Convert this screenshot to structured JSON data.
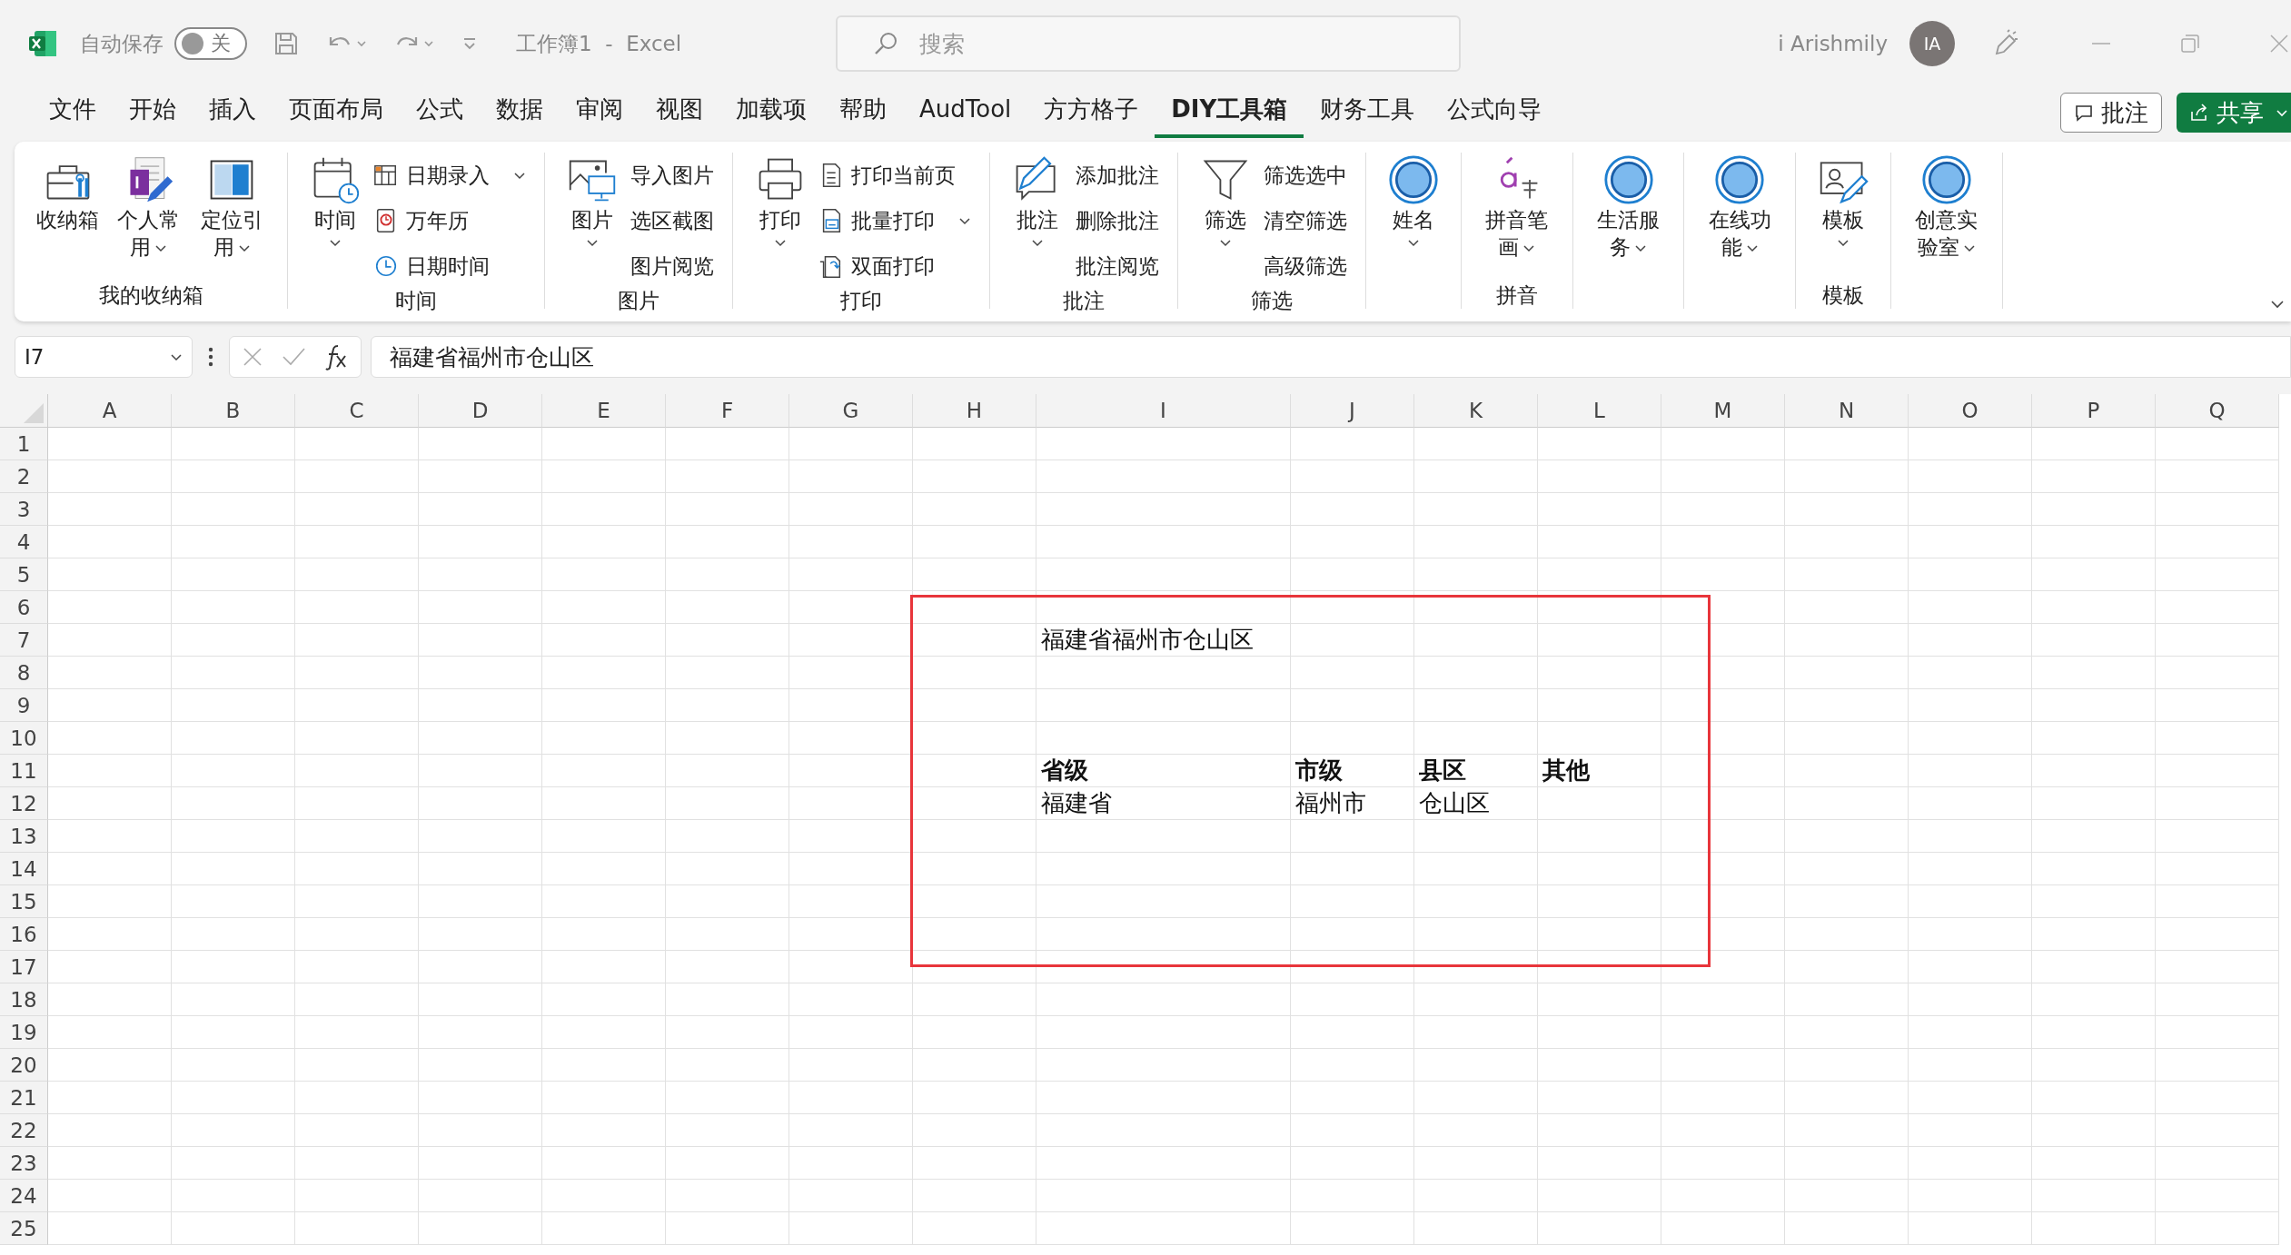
{
  "title_bar": {
    "autosave_label": "自动保存",
    "autosave": {
      "on": false,
      "label": "关"
    },
    "title": "工作簿1  -  Excel",
    "search": {
      "placeholder": "搜索"
    },
    "user": "i Arishmily",
    "avatar": "IA"
  },
  "tabs": [
    {
      "label": "文件",
      "selected": false
    },
    {
      "label": "开始",
      "selected": false
    },
    {
      "label": "插入",
      "selected": false
    },
    {
      "label": "页面布局",
      "selected": false
    },
    {
      "label": "公式",
      "selected": false
    },
    {
      "label": "数据",
      "selected": false
    },
    {
      "label": "审阅",
      "selected": false
    },
    {
      "label": "视图",
      "selected": false
    },
    {
      "label": "加载项",
      "selected": false
    },
    {
      "label": "帮助",
      "selected": false
    },
    {
      "label": "AudTool",
      "selected": false
    },
    {
      "label": "方方格子",
      "selected": false
    },
    {
      "label": "DIY工具箱",
      "selected": true
    },
    {
      "label": "财务工具",
      "selected": false
    },
    {
      "label": "公式向导",
      "selected": false
    }
  ],
  "actions": [
    {
      "kind": "comment",
      "label": "批注"
    },
    {
      "kind": "share",
      "label": "共享"
    }
  ],
  "ribbon": {
    "groups": [
      {
        "label": "我的收纳箱",
        "items": [
          {
            "kind": "large",
            "label": "收纳箱",
            "dropdown": false
          },
          {
            "kind": "large",
            "label": "个人常用",
            "dropdown": true
          },
          {
            "kind": "large",
            "label": "定位引用",
            "dropdown": true
          }
        ]
      },
      {
        "label": "时间",
        "items": [
          {
            "kind": "large",
            "label": "时间",
            "dropdown": true
          },
          {
            "kind": "small",
            "label": "日期录入",
            "dropdown": true
          },
          {
            "kind": "small",
            "label": "万年历",
            "dropdown": false
          },
          {
            "kind": "small",
            "label": "日期时间",
            "dropdown": false
          }
        ]
      },
      {
        "label": "图片",
        "items": [
          {
            "kind": "large",
            "label": "图片",
            "dropdown": true
          },
          {
            "kind": "plain",
            "label": "导入图片",
            "dropdown": false
          },
          {
            "kind": "plain",
            "label": "选区截图",
            "dropdown": false
          },
          {
            "kind": "plain",
            "label": "图片阅览",
            "dropdown": false
          }
        ]
      },
      {
        "label": "打印",
        "items": [
          {
            "kind": "large",
            "label": "打印",
            "dropdown": true
          },
          {
            "kind": "small",
            "label": "打印当前页",
            "dropdown": false
          },
          {
            "kind": "small",
            "label": "批量打印",
            "dropdown": true
          },
          {
            "kind": "small",
            "label": "双面打印",
            "dropdown": false
          }
        ]
      },
      {
        "label": "批注",
        "items": [
          {
            "kind": "large",
            "label": "批注",
            "dropdown": true
          },
          {
            "kind": "plain",
            "label": "添加批注",
            "dropdown": false
          },
          {
            "kind": "plain",
            "label": "删除批注",
            "dropdown": false
          },
          {
            "kind": "plain",
            "label": "批注阅览",
            "dropdown": false
          }
        ]
      },
      {
        "label": "筛选",
        "items": [
          {
            "kind": "large",
            "label": "筛选",
            "dropdown": true
          },
          {
            "kind": "plain",
            "label": "筛选选中",
            "dropdown": false
          },
          {
            "kind": "plain",
            "label": "清空筛选",
            "dropdown": false
          },
          {
            "kind": "plain",
            "label": "高级筛选",
            "dropdown": false
          }
        ]
      },
      {
        "items": [
          {
            "kind": "circle",
            "label": "姓名",
            "dropdown": true
          }
        ]
      },
      {
        "label": "拼音",
        "items": [
          {
            "kind": "large",
            "label": "拼音笔画",
            "dropdown": true
          }
        ]
      },
      {
        "items": [
          {
            "kind": "circle",
            "label": "生活服务",
            "dropdown": true
          }
        ]
      },
      {
        "items": [
          {
            "kind": "circle",
            "label": "在线功能",
            "dropdown": true
          }
        ]
      },
      {
        "label": "模板",
        "items": [
          {
            "kind": "large",
            "label": "模板",
            "dropdown": true
          }
        ]
      },
      {
        "items": [
          {
            "kind": "circle",
            "label": "创意实验室",
            "dropdown": true
          }
        ]
      }
    ]
  },
  "formula_bar": {
    "name_box": "I7",
    "formula": "福建省福州市仓山区"
  },
  "sheet": {
    "columns": [
      {
        "label": "A"
      },
      {
        "label": "B"
      },
      {
        "label": "C"
      },
      {
        "label": "D"
      },
      {
        "label": "E"
      },
      {
        "label": "F"
      },
      {
        "label": "G"
      },
      {
        "label": "H"
      },
      {
        "label": "I",
        "wide": true
      },
      {
        "label": "J"
      },
      {
        "label": "K"
      },
      {
        "label": "L"
      },
      {
        "label": "M"
      },
      {
        "label": "N"
      },
      {
        "label": "O"
      },
      {
        "label": "P"
      },
      {
        "label": "Q"
      }
    ],
    "rows": [
      {
        "header": "1"
      },
      {
        "header": "2"
      },
      {
        "header": "3"
      },
      {
        "header": "4"
      },
      {
        "header": "5"
      },
      {
        "header": "6"
      },
      {
        "header": "7",
        "cells": [
          null,
          null,
          null,
          null,
          null,
          null,
          null,
          null,
          {
            "text": "福建省福州市仓山区",
            "bold": false
          }
        ]
      },
      {
        "header": "8"
      },
      {
        "header": "9"
      },
      {
        "header": "10"
      },
      {
        "header": "11",
        "cells": [
          null,
          null,
          null,
          null,
          null,
          null,
          null,
          null,
          {
            "text": "省级",
            "bold": true
          },
          {
            "text": "市级",
            "bold": true
          },
          {
            "text": "县区",
            "bold": true
          },
          {
            "text": "其他",
            "bold": true
          }
        ]
      },
      {
        "header": "12",
        "cells": [
          null,
          null,
          null,
          null,
          null,
          null,
          null,
          null,
          {
            "text": "福建省",
            "bold": false
          },
          {
            "text": "福州市",
            "bold": false
          },
          {
            "text": "仓山区",
            "bold": false
          }
        ]
      },
      {
        "header": "13"
      },
      {
        "header": "14"
      },
      {
        "header": "15"
      },
      {
        "header": "16"
      },
      {
        "header": "17"
      },
      {
        "header": "18"
      },
      {
        "header": "19"
      },
      {
        "header": "20"
      },
      {
        "header": "21"
      },
      {
        "header": "22"
      },
      {
        "header": "23"
      },
      {
        "header": "24"
      },
      {
        "header": "25"
      }
    ],
    "annotation": {
      "kind": "rectangle"
    }
  }
}
